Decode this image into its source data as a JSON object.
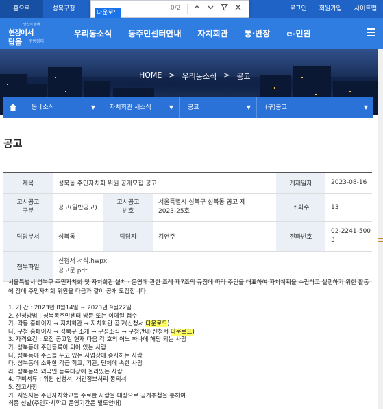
{
  "topbar": {
    "home": "홈으로",
    "org": "성북구청",
    "login": "로그인",
    "join": "회원가입",
    "sitemap": "사이트맵"
  },
  "findbar": {
    "query": "다운로드",
    "count": "0/2"
  },
  "logo": {
    "line0": "당신의 삶에",
    "line1": "현장에서",
    "line2": "답을",
    "line3": "구청장이"
  },
  "nav": {
    "items": [
      "우리동소식",
      "동주민센터안내",
      "자치회관",
      "통·반장",
      "e-민원"
    ]
  },
  "breadcrumb": {
    "home": "HOME",
    "sep1": ">",
    "level1": "우리동소식",
    "sep2": ">",
    "level2": "공고"
  },
  "subnav": {
    "items": [
      "동네소식",
      "자치회관 새소식",
      "공고",
      "(구)공고"
    ]
  },
  "page": {
    "title": "공고"
  },
  "table": {
    "title_label": "제목",
    "title_value": "성북동 주민자치회 위원 공개모집 공고",
    "date_label": "게재일자",
    "date_value": "2023-08-16",
    "type_label": "고시공고\n구분",
    "type_value": "공고(일반공고)",
    "num_label": "고시공고\n번호",
    "num_value": "서울특별시 성북구 성북동 공고 제2023-25호",
    "views_label": "조회수",
    "views_value": "13",
    "dept_label": "담당부서",
    "dept_value": "성북동",
    "person_label": "담당자",
    "person_value": "김연주",
    "phone_label": "전화번호",
    "phone_value": "02-2241-5003",
    "attach_label": "첨부파일",
    "attachments": [
      "신청서 서식.hwpx",
      "공고문.pdf"
    ]
  },
  "content": {
    "intro": "서울특별시 성북구 주민자치회 및 자치회관 설치 · 운영에 관한 조례 제7조의 규정에 따라 주민을 대표하여 자치계획을 수립하고 실행하기 위한 활동에 장애 주민자치회 위원을 다음과 같이 공개 모집합니다.",
    "line1": "1. 기 간 : 2023년 8월14일 ~ 2023년 9월22일",
    "line2": "2. 신청방법 : 성북동주민센터 방문 또는 이메일 접수",
    "line3a": "가. 각동 홈페이지 → 자치회관 → 자치회관 공고(신청서 ",
    "line3b": "다운로드",
    "line3c": ")",
    "line4a": "나. 구청 홈페이지 → 성북구 소개 → 구성소식 → 구청안내(신청서 ",
    "line4b": "다운로드",
    "line4c": ")",
    "line5": "3. 자격요건 : 모집 공고일 현재 다음 각 호의 어느 하나에 해당 되는 사람",
    "line6": "가. 성북동에 주민등록이 되어 있는 사람",
    "line7": "나. 성북동에 주소를 두고 있는 사업장에 종사하는 사람",
    "line8": "다. 성북동에 소재한 각급 학교, 기관, 단체에 속한 사람",
    "line9": "라. 성북동의 외국인 등록대장에 올라있는 사람",
    "line10": "4. 구비서류 : 위원 신청서, 개인정보처리 동의서",
    "line11": "5. 참고사항",
    "line12": "가. 지원자는 주민자치학교를 수료한 사람을 대상으로 공개추첨을 통하여",
    "line13": "최종 선발(주민자치학교 운영기간은 별도안내)"
  }
}
